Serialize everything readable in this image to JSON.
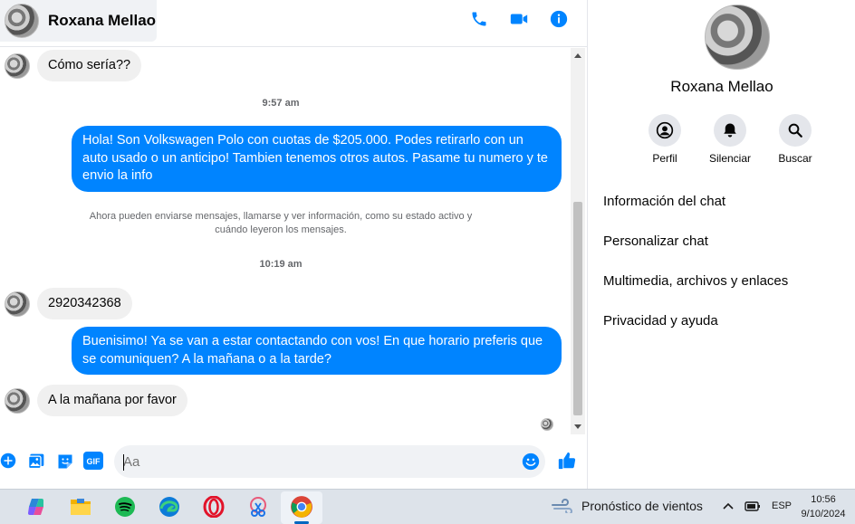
{
  "header": {
    "contact_name": "Roxana Mellao",
    "actions": [
      "phone-icon",
      "video-camera-icon",
      "info-icon"
    ]
  },
  "conversation": {
    "incoming_1": "Cómo sería??",
    "time_1": "9:57 am",
    "outgoing_1": "Hola! Son Volkswagen Polo con cuotas de $205.000. Podes retirarlo con un auto usado o un anticipo! Tambien tenemos otros autos. Pasame tu numero y te envio la info",
    "notice": "Ahora pueden enviarse mensajes, llamarse y ver información, como su estado activo y cuándo leyeron los mensajes.",
    "time_2": "10:19 am",
    "incoming_2": "2920342368",
    "outgoing_2": "Buenisimo! Ya se van a estar contactando con vos! En que horario preferis que se comuniquen? A la mañana o a la tarde?",
    "incoming_3": "A la mañana por favor"
  },
  "composer": {
    "placeholder": "Aa",
    "tools": [
      "plus-icon",
      "image-icon",
      "sticker-icon",
      "gif-icon"
    ],
    "gif_label": "GIF"
  },
  "info_panel": {
    "name": "Roxana Mellao",
    "actions": [
      {
        "label": "Perfil",
        "icon": "profile-icon"
      },
      {
        "label": "Silenciar",
        "icon": "bell-icon"
      },
      {
        "label": "Buscar",
        "icon": "search-icon"
      }
    ],
    "menu": [
      "Información del chat",
      "Personalizar chat",
      "Multimedia, archivos y enlaces",
      "Privacidad y ayuda"
    ]
  },
  "taskbar": {
    "weather": "Pronóstico de vientos",
    "language": "ESP",
    "time": "10:56",
    "date": "9/10/2024"
  },
  "colors": {
    "accent": "#0084ff",
    "incoming_bubble": "#f0f0f0"
  }
}
